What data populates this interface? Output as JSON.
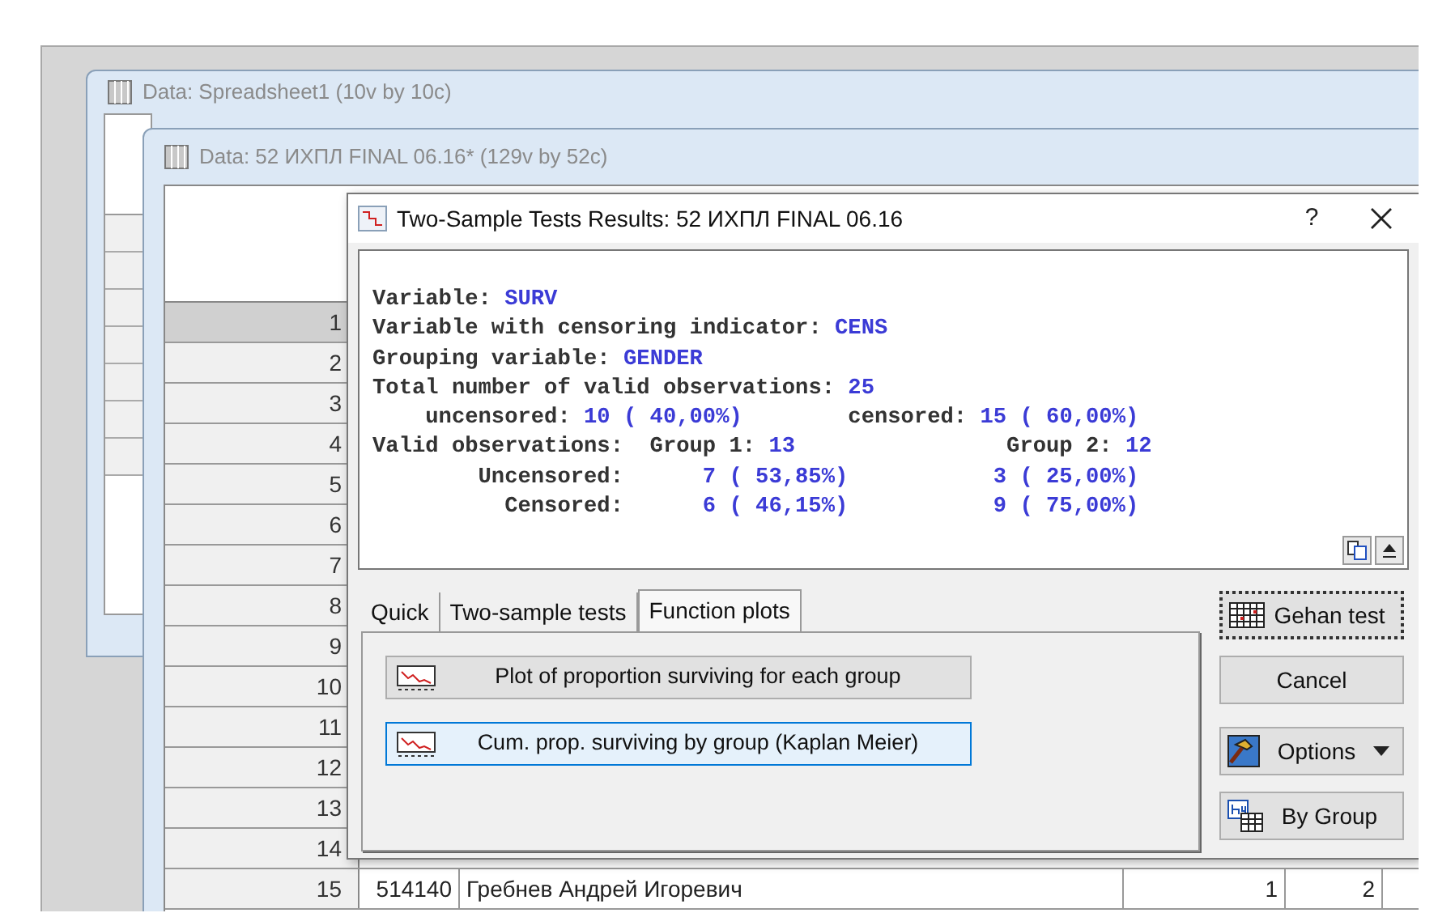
{
  "back_window": {
    "title": "Data: Spreadsheet1 (10v by 10c)"
  },
  "spreadsheet_window": {
    "title": "Data: 52 ИХПЛ FINAL 06.16* (129v by 52c)",
    "rows": [
      {
        "number": "1",
        "selected": true
      },
      {
        "number": "2",
        "selected": false
      },
      {
        "number": "3",
        "selected": false
      },
      {
        "number": "4",
        "selected": false
      },
      {
        "number": "5",
        "selected": false
      },
      {
        "number": "6",
        "selected": false
      },
      {
        "number": "7",
        "selected": false
      },
      {
        "number": "8",
        "selected": false
      },
      {
        "number": "9",
        "selected": false
      },
      {
        "number": "10",
        "selected": false
      },
      {
        "number": "11",
        "selected": false
      },
      {
        "number": "12",
        "selected": false
      },
      {
        "number": "13",
        "selected": false
      },
      {
        "number": "14",
        "selected": false
      },
      {
        "number": "15",
        "selected": false,
        "cells": [
          "514140",
          "Гребнев Андрей Игоревич",
          "1",
          "2"
        ]
      }
    ]
  },
  "dialog": {
    "title": "Two-Sample Tests Results: 52 ИХПЛ FINAL 06.16",
    "help": "?",
    "results": [
      {
        "kind": "pair",
        "label": "Variable:",
        "value": "SURV"
      },
      {
        "kind": "pair",
        "label": "Variable with censoring indicator:",
        "value": "CENS"
      },
      {
        "kind": "pair",
        "label": "Grouping variable:",
        "value": "GENDER"
      },
      {
        "kind": "pair",
        "label": "Total number of valid observations:",
        "value": "25"
      },
      {
        "kind": "split",
        "cells": [
          {
            "label": "uncensored:",
            "value": "10 ( 40,00%)"
          },
          {
            "label": "censored:",
            "value": "15 ( 60,00%)"
          }
        ]
      },
      {
        "kind": "groups",
        "label": "Valid observations:",
        "cells": [
          {
            "label": "Group 1:",
            "value": "13"
          },
          {
            "label": "Group 2:",
            "value": "12"
          }
        ]
      },
      {
        "kind": "counts",
        "label": "Uncensored:",
        "values": [
          "7 ( 53,85%)",
          "3 ( 25,00%)"
        ]
      },
      {
        "kind": "counts",
        "label": "Censored:",
        "values": [
          "6 ( 46,15%)",
          "9 ( 75,00%)"
        ]
      }
    ],
    "tabs": [
      {
        "label": "Quick",
        "selected": false
      },
      {
        "label": "Two-sample tests",
        "selected": false
      },
      {
        "label": "Function plots",
        "selected": true
      }
    ],
    "plot_buttons": [
      {
        "label": "Plot of proportion surviving for each group",
        "focused": false
      },
      {
        "label": "Cum. prop. surviving by group (Kaplan Meier)",
        "focused": true
      }
    ],
    "side_buttons": [
      {
        "label": "Gehan test",
        "kind": "table",
        "default": true
      },
      {
        "label": "Cancel",
        "kind": "plain",
        "default": false
      },
      {
        "label": "Options",
        "kind": "options",
        "default": false
      },
      {
        "label": "By Group",
        "kind": "bygroup",
        "default": false
      }
    ]
  }
}
